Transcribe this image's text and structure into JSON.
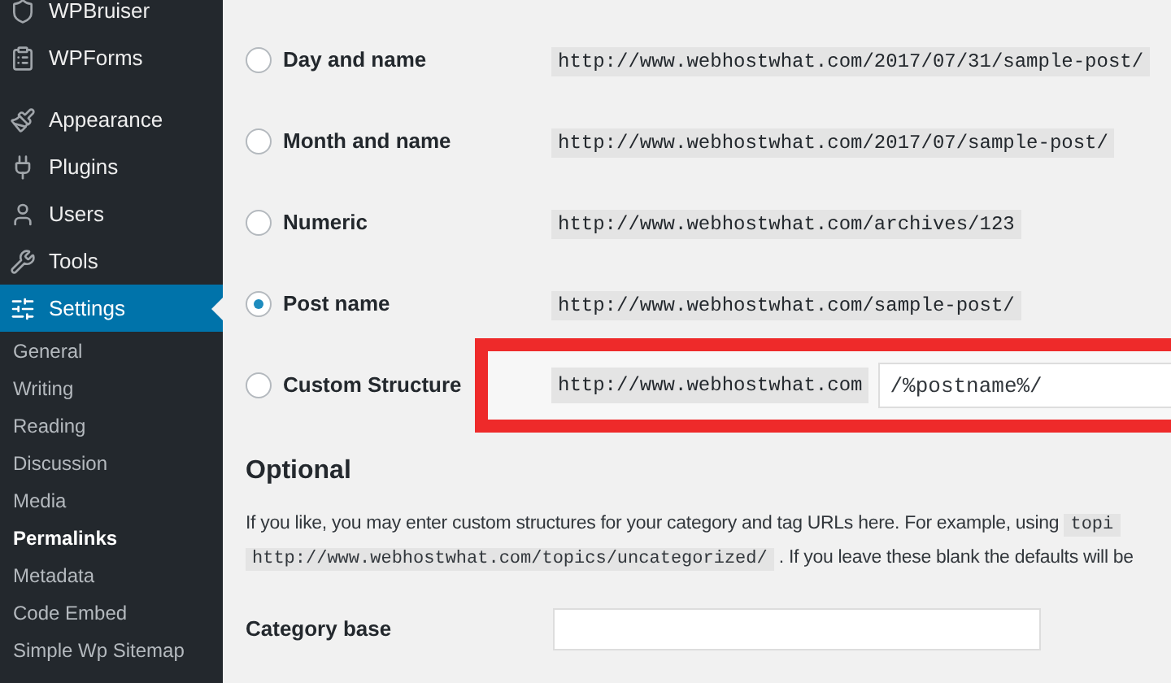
{
  "sidebar": {
    "items": [
      {
        "label": "WPBruiser",
        "kind": "top",
        "selected": false
      },
      {
        "label": "WPForms",
        "kind": "top",
        "selected": false
      },
      {
        "label": "Appearance",
        "kind": "top",
        "selected": false
      },
      {
        "label": "Plugins",
        "kind": "top",
        "selected": false
      },
      {
        "label": "Users",
        "kind": "top",
        "selected": false
      },
      {
        "label": "Tools",
        "kind": "top",
        "selected": false
      },
      {
        "label": "Settings",
        "kind": "top",
        "selected": true
      },
      {
        "label": "General",
        "kind": "sub",
        "selected": false
      },
      {
        "label": "Writing",
        "kind": "sub",
        "selected": false
      },
      {
        "label": "Reading",
        "kind": "sub",
        "selected": false
      },
      {
        "label": "Discussion",
        "kind": "sub",
        "selected": false
      },
      {
        "label": "Media",
        "kind": "sub",
        "selected": false
      },
      {
        "label": "Permalinks",
        "kind": "sub",
        "selected": true
      },
      {
        "label": "Metadata",
        "kind": "sub",
        "selected": false
      },
      {
        "label": "Code Embed",
        "kind": "sub",
        "selected": false
      },
      {
        "label": "Simple Wp Sitemap",
        "kind": "sub",
        "selected": false
      }
    ]
  },
  "options": [
    {
      "label": "Day and name",
      "example": "http://www.webhostwhat.com/2017/07/31/sample-post/",
      "selected": false
    },
    {
      "label": "Month and name",
      "example": "http://www.webhostwhat.com/2017/07/sample-post/",
      "selected": false
    },
    {
      "label": "Numeric",
      "example": "http://www.webhostwhat.com/archives/123",
      "selected": false
    },
    {
      "label": "Post name",
      "example": "http://www.webhostwhat.com/sample-post/",
      "selected": true
    },
    {
      "label": "Custom Structure",
      "prefix": "http://www.webhostwhat.com",
      "value": "/%postname%/",
      "selected": false
    }
  ],
  "optional": {
    "heading": "Optional",
    "description": [
      {
        "kind": "text",
        "text": "If you like, you may enter custom structures for your category and tag URLs here. For example, using "
      },
      {
        "kind": "code",
        "text": "topi"
      },
      {
        "kind": "break"
      },
      {
        "kind": "code",
        "text": "http://www.webhostwhat.com/topics/uncategorized/"
      },
      {
        "kind": "text",
        "text": " . If you leave these blank the defaults will be"
      }
    ],
    "fields": [
      {
        "label": "Category base"
      }
    ]
  }
}
